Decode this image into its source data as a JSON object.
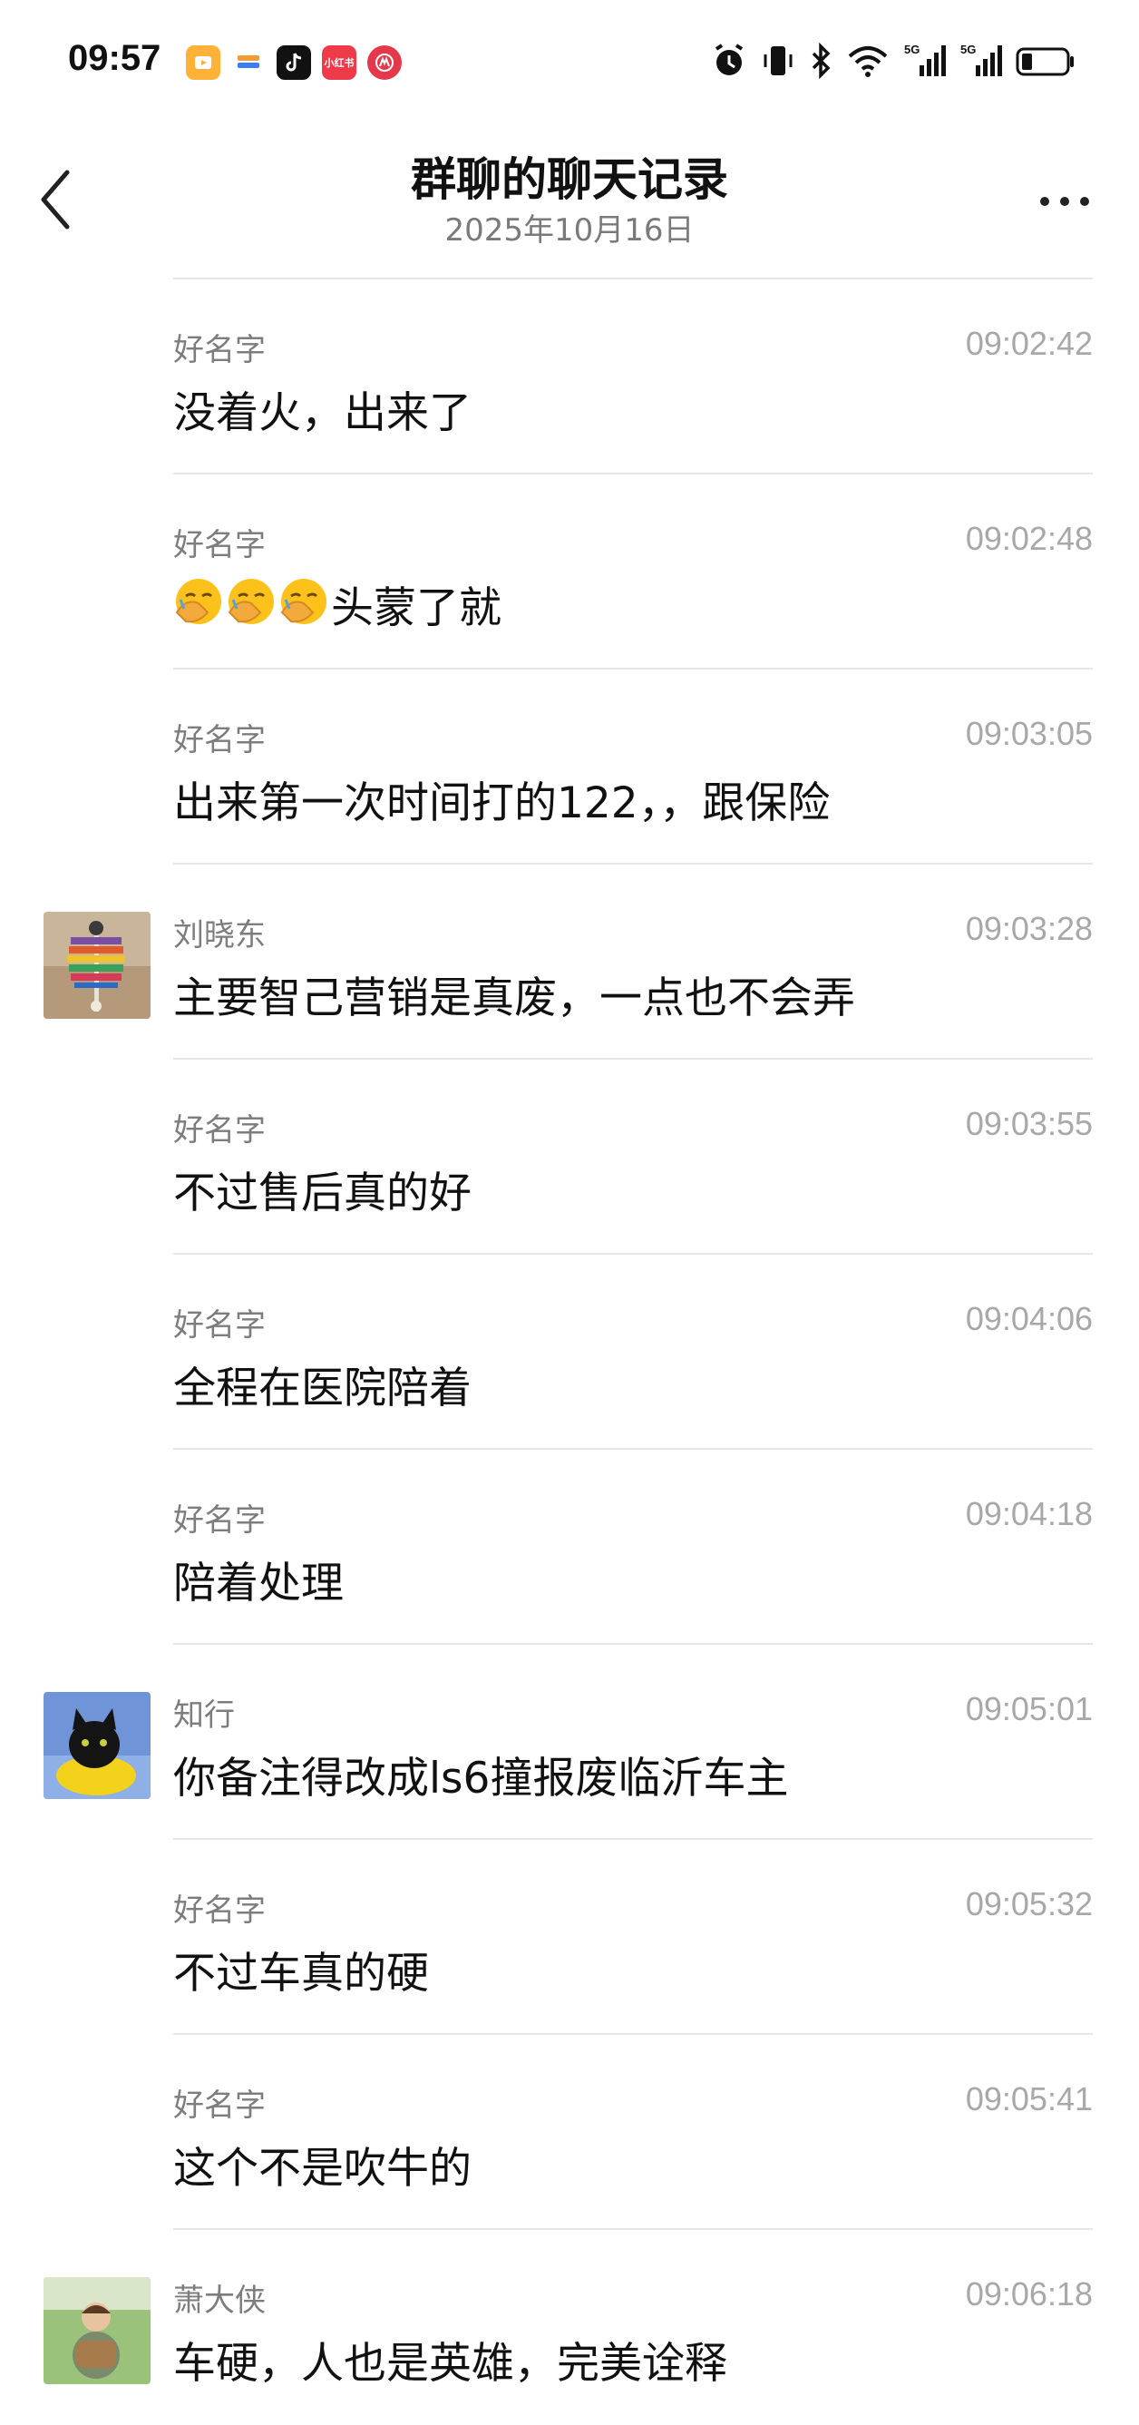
{
  "status_bar": {
    "time": "09:57",
    "app_icons": [
      {
        "name": "video-app-icon",
        "color": "#ffb237",
        "label": ""
      },
      {
        "name": "wallet-app-icon",
        "color": "#3d7cf5",
        "label": ""
      },
      {
        "name": "tiktok-icon",
        "color": "#111111",
        "label": ""
      },
      {
        "name": "xiaohongshu-icon",
        "color": "#ef3a4a",
        "label": "小红书"
      },
      {
        "name": "bank-app-icon",
        "color": "#e4394a",
        "label": ""
      }
    ],
    "signal_label_1": "5G",
    "signal_label_2": "5G"
  },
  "header": {
    "title": "群聊的聊天记录",
    "subtitle": "2025年10月16日"
  },
  "colors": {
    "divider": "#e6e6e6",
    "sender": "#7d7d7d",
    "timestamp": "#a8a8a8"
  },
  "messages": [
    {
      "sender": "好名字",
      "time": "09:02:42",
      "text": "没着火，出来了",
      "avatar": null
    },
    {
      "sender": "好名字",
      "time": "09:02:48",
      "text": "头蒙了就",
      "avatar": null,
      "emoji_prefix": [
        "facepalm-emoji",
        "facepalm-emoji",
        "facepalm-emoji"
      ]
    },
    {
      "sender": "好名字",
      "time": "09:03:05",
      "text": "出来第一次时间打的122，，跟保险",
      "avatar": null
    },
    {
      "sender": "刘晓东",
      "time": "09:03:28",
      "text": "主要智己营销是真废，一点也不会弄",
      "avatar": "pinwheel-photo-avatar"
    },
    {
      "sender": "好名字",
      "time": "09:03:55",
      "text": "不过售后真的好",
      "avatar": null
    },
    {
      "sender": "好名字",
      "time": "09:04:06",
      "text": "全程在医院陪着",
      "avatar": null
    },
    {
      "sender": "好名字",
      "time": "09:04:18",
      "text": "陪着处理",
      "avatar": null
    },
    {
      "sender": "知行",
      "time": "09:05:01",
      "text": "你备注得改成ls6撞报废临沂车主",
      "avatar": "black-cat-avatar"
    },
    {
      "sender": "好名字",
      "time": "09:05:32",
      "text": "不过车真的硬",
      "avatar": null
    },
    {
      "sender": "好名字",
      "time": "09:05:41",
      "text": "这个不是吹牛的",
      "avatar": null
    },
    {
      "sender": "萧大侠",
      "time": "09:06:18",
      "text": "车硬，人也是英雄，完美诠释",
      "avatar": "child-on-grass-avatar"
    }
  ]
}
